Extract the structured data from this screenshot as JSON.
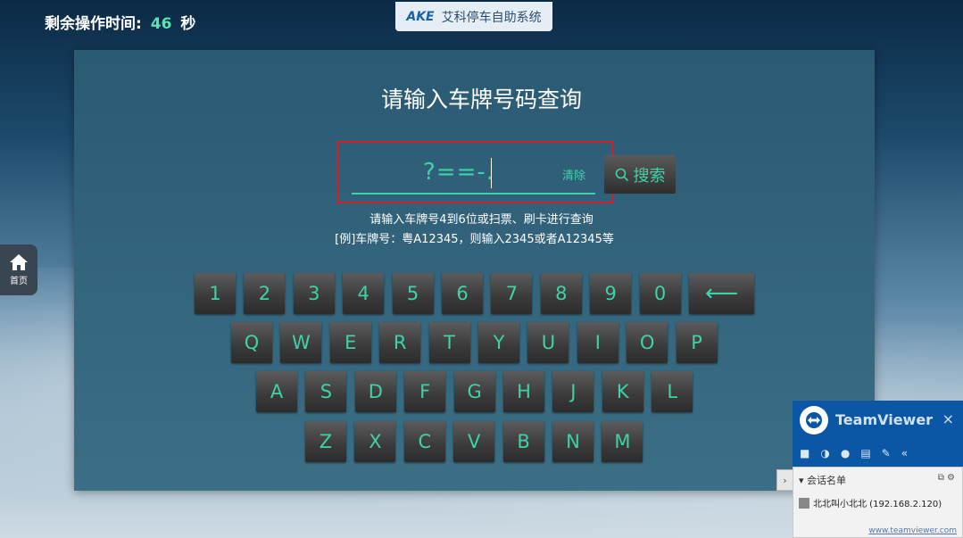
{
  "timer": {
    "label": "剩余操作时间:",
    "seconds": "46",
    "unit": "秒"
  },
  "brand": {
    "logo": "AKE",
    "name": "艾科停车自助系统"
  },
  "main": {
    "title": "请输入车牌号码查询",
    "input_value": "?==-.",
    "clear_label": "清除",
    "search_label": "搜索",
    "hint_line1": "请输入车牌号4到6位或扫票、刷卡进行查询",
    "hint_line2": "[例]车牌号：粤A12345，则输入2345或者A12345等",
    "accent_color": "#3fd2a8"
  },
  "sidebar": {
    "home_label": "首页",
    "home_icon": "home-icon"
  },
  "keyboard": {
    "row1": [
      "1",
      "2",
      "3",
      "4",
      "5",
      "6",
      "7",
      "8",
      "9",
      "0"
    ],
    "backspace": "⟵",
    "row2": [
      "Q",
      "W",
      "E",
      "R",
      "T",
      "Y",
      "U",
      "I",
      "O",
      "P"
    ],
    "row3": [
      "A",
      "S",
      "D",
      "F",
      "G",
      "H",
      "J",
      "K",
      "L"
    ],
    "row4": [
      "Z",
      "X",
      "C",
      "V",
      "B",
      "N",
      "M"
    ]
  },
  "teamviewer": {
    "title": "TeamViewer",
    "close": "×",
    "section_label": "会话名单",
    "session_entry": "北北叫小北北 (192.168.2.120)",
    "link": "www.teamviewer.com",
    "tab_arrow": "›",
    "tool_more": "«"
  }
}
